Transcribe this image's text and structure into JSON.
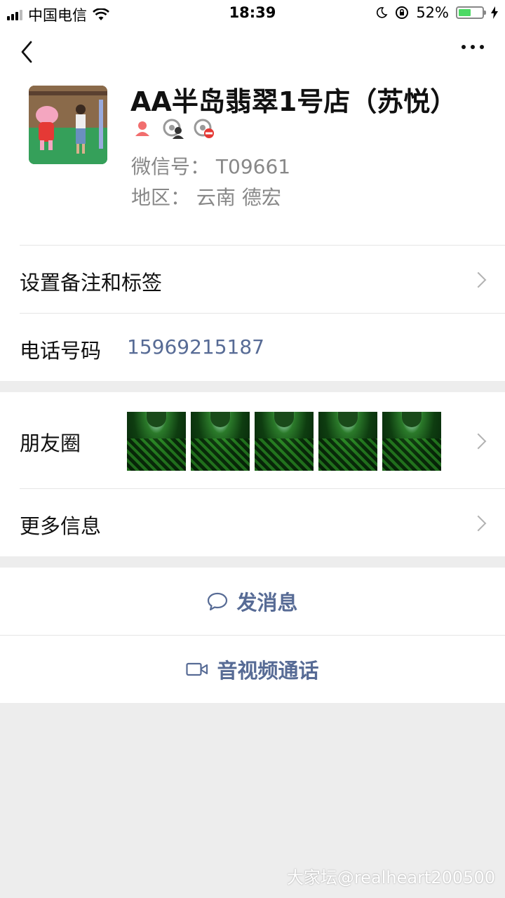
{
  "status_bar": {
    "carrier": "中国电信",
    "time": "18:39",
    "battery_percent": "52%",
    "battery_level": 0.52
  },
  "profile": {
    "name": "AA半岛翡翠1号店（苏悦）",
    "wechat_id_label": "微信号：",
    "wechat_id": "T09661",
    "region_label": "地区：",
    "region": "云南 德宏",
    "badges": [
      "female-icon",
      "moments-unfollow-icon",
      "moments-block-icon"
    ]
  },
  "rows": {
    "remark_label": "设置备注和标签",
    "phone_label": "电话号码",
    "phone_value": "15969215187",
    "moments_label": "朋友圈",
    "more_info_label": "更多信息"
  },
  "moments_photos_count": 5,
  "actions": {
    "message_label": "发消息",
    "call_label": "音视频通话"
  },
  "watermark": "大家坛@realheart200500",
  "colors": {
    "link_blue": "#576b95",
    "background": "#ededed",
    "battery_green": "#4cd964",
    "female_red": "#f16e6e"
  }
}
